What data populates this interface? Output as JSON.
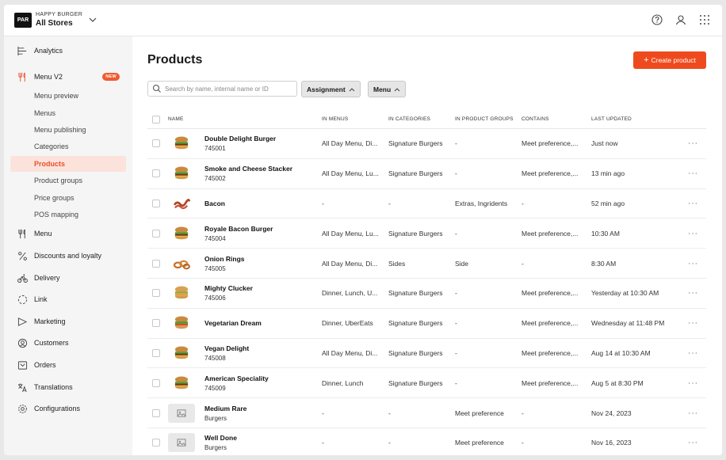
{
  "brand": {
    "logo_text": "PAR",
    "org": "HAPPY BURGER",
    "store": "All Stores"
  },
  "top_icons": [
    "help-icon",
    "user-icon",
    "apps-grid-icon"
  ],
  "sidebar": {
    "items": [
      {
        "label": "Analytics",
        "icon": "analytics-icon",
        "type": "main"
      },
      {
        "label": "Menu V2",
        "icon": "fork-knife-icon",
        "type": "main",
        "badge": "NEW"
      },
      {
        "label": "Menu preview",
        "type": "sub"
      },
      {
        "label": "Menus",
        "type": "sub"
      },
      {
        "label": "Menu publishing",
        "type": "sub"
      },
      {
        "label": "Categories",
        "type": "sub"
      },
      {
        "label": "Products",
        "type": "sub",
        "active": true
      },
      {
        "label": "Product groups",
        "type": "sub"
      },
      {
        "label": "Price groups",
        "type": "sub"
      },
      {
        "label": "POS mapping",
        "type": "sub"
      },
      {
        "label": "Menu",
        "icon": "fork-knife-icon",
        "type": "main"
      },
      {
        "label": "Discounts and loyalty",
        "icon": "percent-icon",
        "type": "main"
      },
      {
        "label": "Delivery",
        "icon": "bike-icon",
        "type": "main"
      },
      {
        "label": "Link",
        "icon": "link-circle-icon",
        "type": "main"
      },
      {
        "label": "Marketing",
        "icon": "megaphone-icon",
        "type": "main"
      },
      {
        "label": "Customers",
        "icon": "customers-icon",
        "type": "main"
      },
      {
        "label": "Orders",
        "icon": "orders-icon",
        "type": "main"
      },
      {
        "label": "Translations",
        "icon": "translate-icon",
        "type": "main"
      },
      {
        "label": "Configurations",
        "icon": "gear-icon",
        "type": "main"
      }
    ]
  },
  "main": {
    "title": "Products",
    "create_button": "Create product",
    "search_placeholder": "Search by name, internal name or ID",
    "filters": [
      "Assignment",
      "Menu"
    ]
  },
  "table": {
    "columns": [
      "NAME",
      "IN MENUS",
      "IN CATEGORIES",
      "IN PRODUCT GROUPS",
      "CONTAINS",
      "LAST UPDATED"
    ],
    "rows": [
      {
        "name": "Double Delight Burger",
        "sub": "745001",
        "menus": "All Day Menu, Di...",
        "categories": "Signature Burgers",
        "groups": "-",
        "contains": "Meet preference,...",
        "updated": "Just now",
        "thumb": "burger"
      },
      {
        "name": "Smoke and Cheese Stacker",
        "sub": "745002",
        "menus": "All Day Menu, Lu...",
        "categories": "Signature Burgers",
        "groups": "-",
        "contains": "Meet preference,...",
        "updated": "13 min ago",
        "thumb": "burger"
      },
      {
        "name": "Bacon",
        "sub": "",
        "menus": "-",
        "categories": "-",
        "groups": "Extras, Ingridents",
        "contains": "-",
        "updated": "52 min ago",
        "thumb": "bacon"
      },
      {
        "name": "Royale Bacon Burger",
        "sub": "745004",
        "menus": "All Day Menu, Lu...",
        "categories": "Signature Burgers",
        "groups": "-",
        "contains": "Meet preference,...",
        "updated": "10:30 AM",
        "thumb": "burger"
      },
      {
        "name": "Onion Rings",
        "sub": "745005",
        "menus": "All Day Menu, Di...",
        "categories": "Sides",
        "groups": "Side",
        "contains": "-",
        "updated": "8:30 AM",
        "thumb": "rings"
      },
      {
        "name": "Mighty Clucker",
        "sub": "745006",
        "menus": "Dinner, Lunch, U...",
        "categories": "Signature Burgers",
        "groups": "-",
        "contains": "Meet preference,...",
        "updated": "Yesterday at 10:30 AM",
        "thumb": "chicken"
      },
      {
        "name": "Vegetarian Dream",
        "sub": "",
        "menus": "Dinner, UberEats",
        "categories": "Signature Burgers",
        "groups": "-",
        "contains": "Meet preference,...",
        "updated": "Wednesday at 11:48 PM",
        "thumb": "veggie"
      },
      {
        "name": "Vegan Delight",
        "sub": "745008",
        "menus": "All Day Menu, Di...",
        "categories": "Signature Burgers",
        "groups": "-",
        "contains": "Meet preference,...",
        "updated": "Aug 14 at 10:30 AM",
        "thumb": "burger"
      },
      {
        "name": "American Speciality",
        "sub": "745009",
        "menus": "Dinner, Lunch",
        "categories": "Signature Burgers",
        "groups": "-",
        "contains": "Meet preference,...",
        "updated": "Aug 5 at 8:30 PM",
        "thumb": "burger"
      },
      {
        "name": "Medium Rare",
        "sub": "Burgers",
        "menus": "-",
        "categories": "-",
        "groups": "Meet preference",
        "contains": "-",
        "updated": "Nov 24, 2023",
        "thumb": "placeholder"
      },
      {
        "name": "Well Done",
        "sub": "Burgers",
        "menus": "-",
        "categories": "-",
        "groups": "Meet preference",
        "contains": "-",
        "updated": "Nov 16, 2023",
        "thumb": "placeholder"
      }
    ]
  },
  "colors": {
    "accent": "#ef4a1e",
    "active_bg": "#fbe3dc",
    "sidebar_bg": "#f5f5f5"
  }
}
